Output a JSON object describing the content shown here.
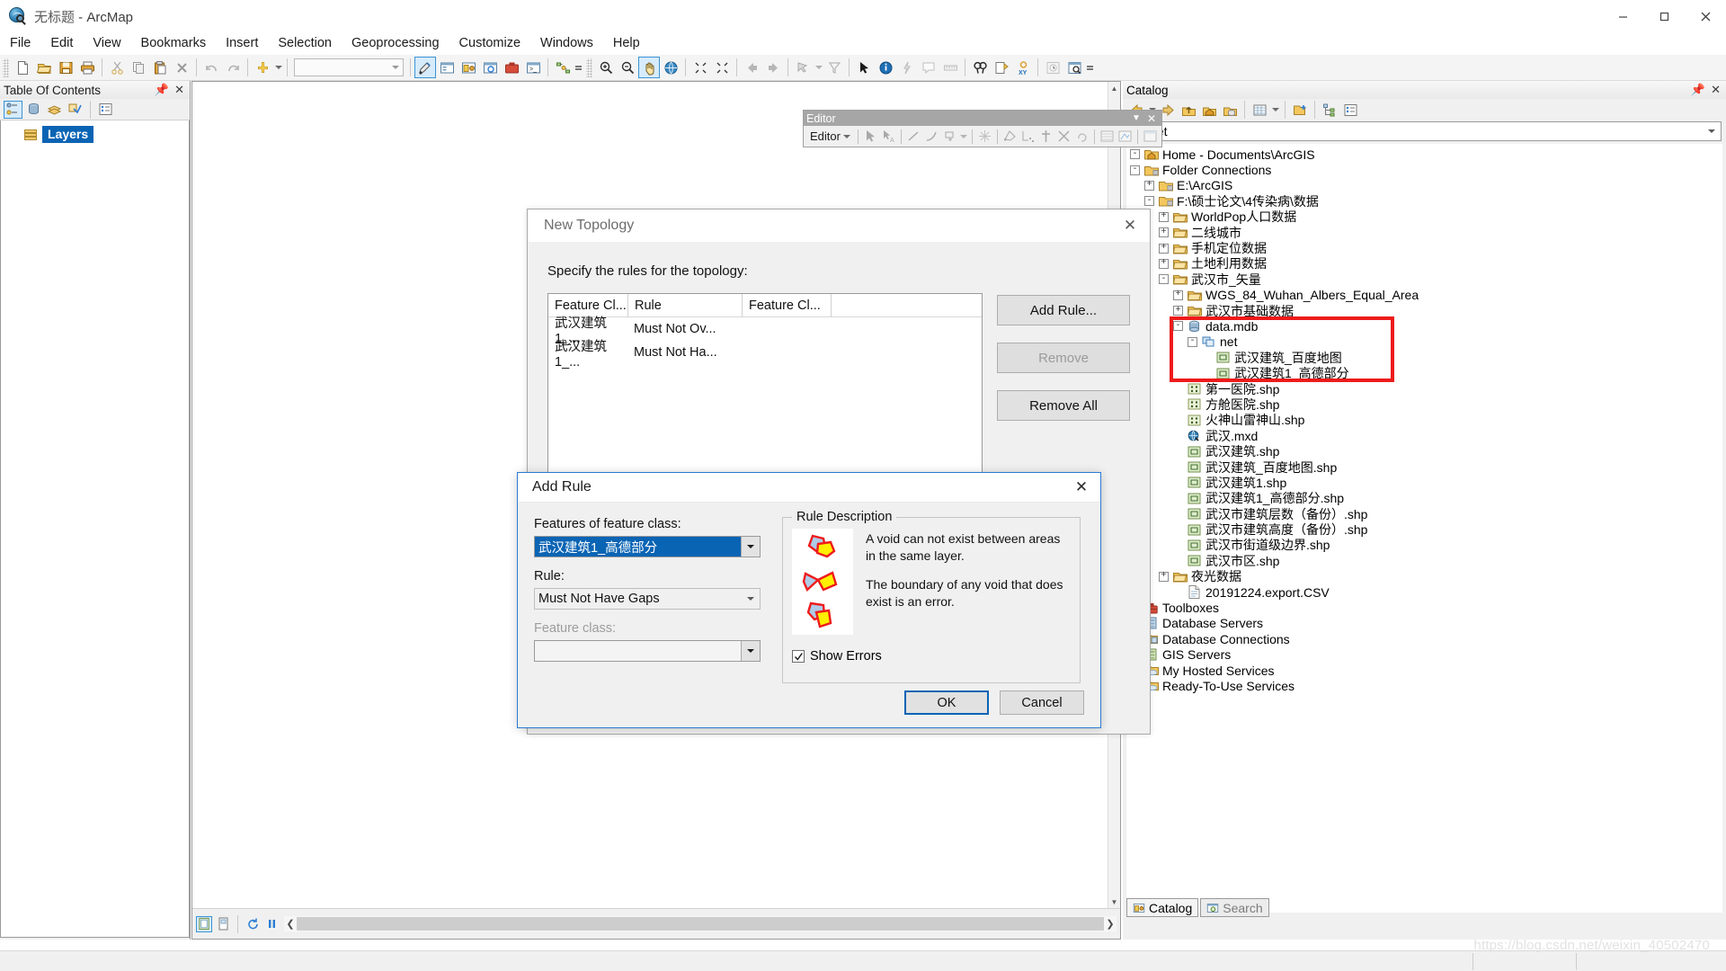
{
  "window": {
    "title_doc": "无标题",
    "title_app": " - ArcMap",
    "minimize": "minimize-icon",
    "maximize": "maximize-icon",
    "close": "close-icon"
  },
  "menubar": {
    "items": [
      {
        "label": "File"
      },
      {
        "label": "Edit"
      },
      {
        "label": "View"
      },
      {
        "label": "Bookmarks"
      },
      {
        "label": "Insert"
      },
      {
        "label": "Selection"
      },
      {
        "label": "Geoprocessing"
      },
      {
        "label": "Customize"
      },
      {
        "label": "Windows"
      },
      {
        "label": "Help"
      }
    ]
  },
  "toc": {
    "title": "Table Of Contents",
    "pin": "pin-icon",
    "close": "close-icon",
    "tools": [
      "list-by-drawing-order-icon",
      "list-by-source-icon",
      "list-by-visibility-icon",
      "list-by-selection-icon",
      "options-icon"
    ],
    "root_layer": "Layers"
  },
  "editor_toolbar": {
    "caption": "Editor",
    "menu_label": "Editor",
    "collapse": "chevron-down-icon",
    "close": "close-icon"
  },
  "topology_dialog": {
    "title": "New Topology",
    "close": "close-icon",
    "instruction": "Specify the rules for the topology:",
    "columns": [
      "Feature Cl...",
      "Rule",
      "Feature Cl..."
    ],
    "rows": [
      {
        "feature_class": "武汉建筑1_...",
        "rule": "Must Not Ov...",
        "feature_class2": ""
      },
      {
        "feature_class": "武汉建筑1_...",
        "rule": "Must Not Ha...",
        "feature_class2": ""
      }
    ],
    "buttons": {
      "add_rule": "Add Rule...",
      "remove": "Remove",
      "remove_all": "Remove All"
    }
  },
  "add_rule_dialog": {
    "title": "Add Rule",
    "close": "close-icon",
    "feature_class_label": "Features of feature class:",
    "feature_class_value": "武汉建筑1_高德部分",
    "rule_label": "Rule:",
    "rule_value": "Must Not Have Gaps",
    "second_feature_class_label": "Feature class:",
    "second_feature_class_value": "",
    "rule_description_legend": "Rule Description",
    "rule_description_p1": "A void can not exist between areas in the same layer.",
    "rule_description_p2": "The boundary of any void that does exist is an error.",
    "show_errors_label": "Show Errors",
    "show_errors_checked": true,
    "ok": "OK",
    "cancel": "Cancel"
  },
  "catalog": {
    "title": "Catalog",
    "pin": "pin-icon",
    "close": "close-icon",
    "toolbar": [
      "back-icon",
      "forward-icon",
      "up-one-level-icon",
      "home-icon",
      "default-geodatabase-icon",
      "contents-view-icon",
      "connect-folder-icon",
      "toggle-tree-icon",
      "options-icon"
    ],
    "location_value": "net",
    "location_icon": "feature-dataset-icon",
    "tree": [
      {
        "label": "Home - Documents\\ArcGIS",
        "indent": 0,
        "expander": "-",
        "icon": "home-folder-icon"
      },
      {
        "label": "Folder Connections",
        "indent": 0,
        "expander": "-",
        "icon": "folder-connection-icon"
      },
      {
        "label": "E:\\ArcGIS",
        "indent": 1,
        "expander": "+",
        "icon": "folder-connection-icon"
      },
      {
        "label": "F:\\硕士论文\\4传染病\\数据",
        "indent": 1,
        "expander": "-",
        "icon": "folder-connection-icon"
      },
      {
        "label": "WorldPop人口数据",
        "indent": 2,
        "expander": "+",
        "icon": "folder-icon"
      },
      {
        "label": "二线城市",
        "indent": 2,
        "expander": "+",
        "icon": "folder-icon"
      },
      {
        "label": "手机定位数据",
        "indent": 2,
        "expander": "+",
        "icon": "folder-icon"
      },
      {
        "label": "土地利用数据",
        "indent": 2,
        "expander": "+",
        "icon": "folder-icon"
      },
      {
        "label": "武汉市_矢量",
        "indent": 2,
        "expander": "-",
        "icon": "folder-icon"
      },
      {
        "label": "WGS_84_Wuhan_Albers_Equal_Area",
        "indent": 3,
        "expander": "+",
        "icon": "folder-icon"
      },
      {
        "label": "武汉市基础数据",
        "indent": 3,
        "expander": "+",
        "icon": "folder-icon"
      },
      {
        "label": "data.mdb",
        "indent": 3,
        "expander": "-",
        "icon": "personal-geodatabase-icon"
      },
      {
        "label": "net",
        "indent": 4,
        "expander": "-",
        "icon": "feature-dataset-icon"
      },
      {
        "label": "武汉建筑_百度地图",
        "indent": 5,
        "expander": "",
        "icon": "polygon-feature-class-icon"
      },
      {
        "label": "武汉建筑1_高德部分",
        "indent": 5,
        "expander": "",
        "icon": "polygon-feature-class-icon"
      },
      {
        "label": "第一医院.shp",
        "indent": 3,
        "expander": "",
        "icon": "point-shapefile-icon"
      },
      {
        "label": "方舱医院.shp",
        "indent": 3,
        "expander": "",
        "icon": "point-shapefile-icon"
      },
      {
        "label": "火神山雷神山.shp",
        "indent": 3,
        "expander": "",
        "icon": "point-shapefile-icon"
      },
      {
        "label": "武汉.mxd",
        "indent": 3,
        "expander": "",
        "icon": "map-document-icon"
      },
      {
        "label": "武汉建筑.shp",
        "indent": 3,
        "expander": "",
        "icon": "polygon-shapefile-icon"
      },
      {
        "label": "武汉建筑_百度地图.shp",
        "indent": 3,
        "expander": "",
        "icon": "polygon-shapefile-icon"
      },
      {
        "label": "武汉建筑1.shp",
        "indent": 3,
        "expander": "",
        "icon": "polygon-shapefile-icon"
      },
      {
        "label": "武汉建筑1_高德部分.shp",
        "indent": 3,
        "expander": "",
        "icon": "polygon-shapefile-icon"
      },
      {
        "label": "武汉市建筑层数（备份）.shp",
        "indent": 3,
        "expander": "",
        "icon": "polygon-shapefile-icon"
      },
      {
        "label": "武汉市建筑高度（备份）.shp",
        "indent": 3,
        "expander": "",
        "icon": "polygon-shapefile-icon"
      },
      {
        "label": "武汉市街道级边界.shp",
        "indent": 3,
        "expander": "",
        "icon": "polygon-shapefile-icon"
      },
      {
        "label": "武汉市区.shp",
        "indent": 3,
        "expander": "",
        "icon": "polygon-shapefile-icon"
      },
      {
        "label": "夜光数据",
        "indent": 2,
        "expander": "+",
        "icon": "folder-icon"
      },
      {
        "label": "20191224.export.CSV",
        "indent": 3,
        "expander": "",
        "icon": "csv-file-icon"
      },
      {
        "label": "Toolboxes",
        "indent": 0,
        "expander": "",
        "icon": "toolbox-icon"
      },
      {
        "label": "Database Servers",
        "indent": 0,
        "expander": "",
        "icon": "database-server-icon"
      },
      {
        "label": "Database Connections",
        "indent": 0,
        "expander": "",
        "icon": "database-connection-icon"
      },
      {
        "label": "GIS Servers",
        "indent": 0,
        "expander": "",
        "icon": "gis-server-icon"
      },
      {
        "label": "My Hosted Services",
        "indent": 0,
        "expander": "",
        "icon": "hosted-services-icon"
      },
      {
        "label": "Ready-To-Use Services",
        "indent": 0,
        "expander": "",
        "icon": "ready-to-use-services-icon"
      }
    ],
    "highlight_color": "#ee1b1b",
    "tabs": [
      {
        "label": "Catalog",
        "active": true
      },
      {
        "label": "Search",
        "active": false
      }
    ]
  },
  "statusbar": {
    "watermark": "https://blog.csdn.net/weixin_40502470"
  },
  "colors": {
    "selection_blue": "#0a64b4",
    "dialog_accent": "#2b7cd3",
    "highlight_red": "#ee1b1b"
  }
}
